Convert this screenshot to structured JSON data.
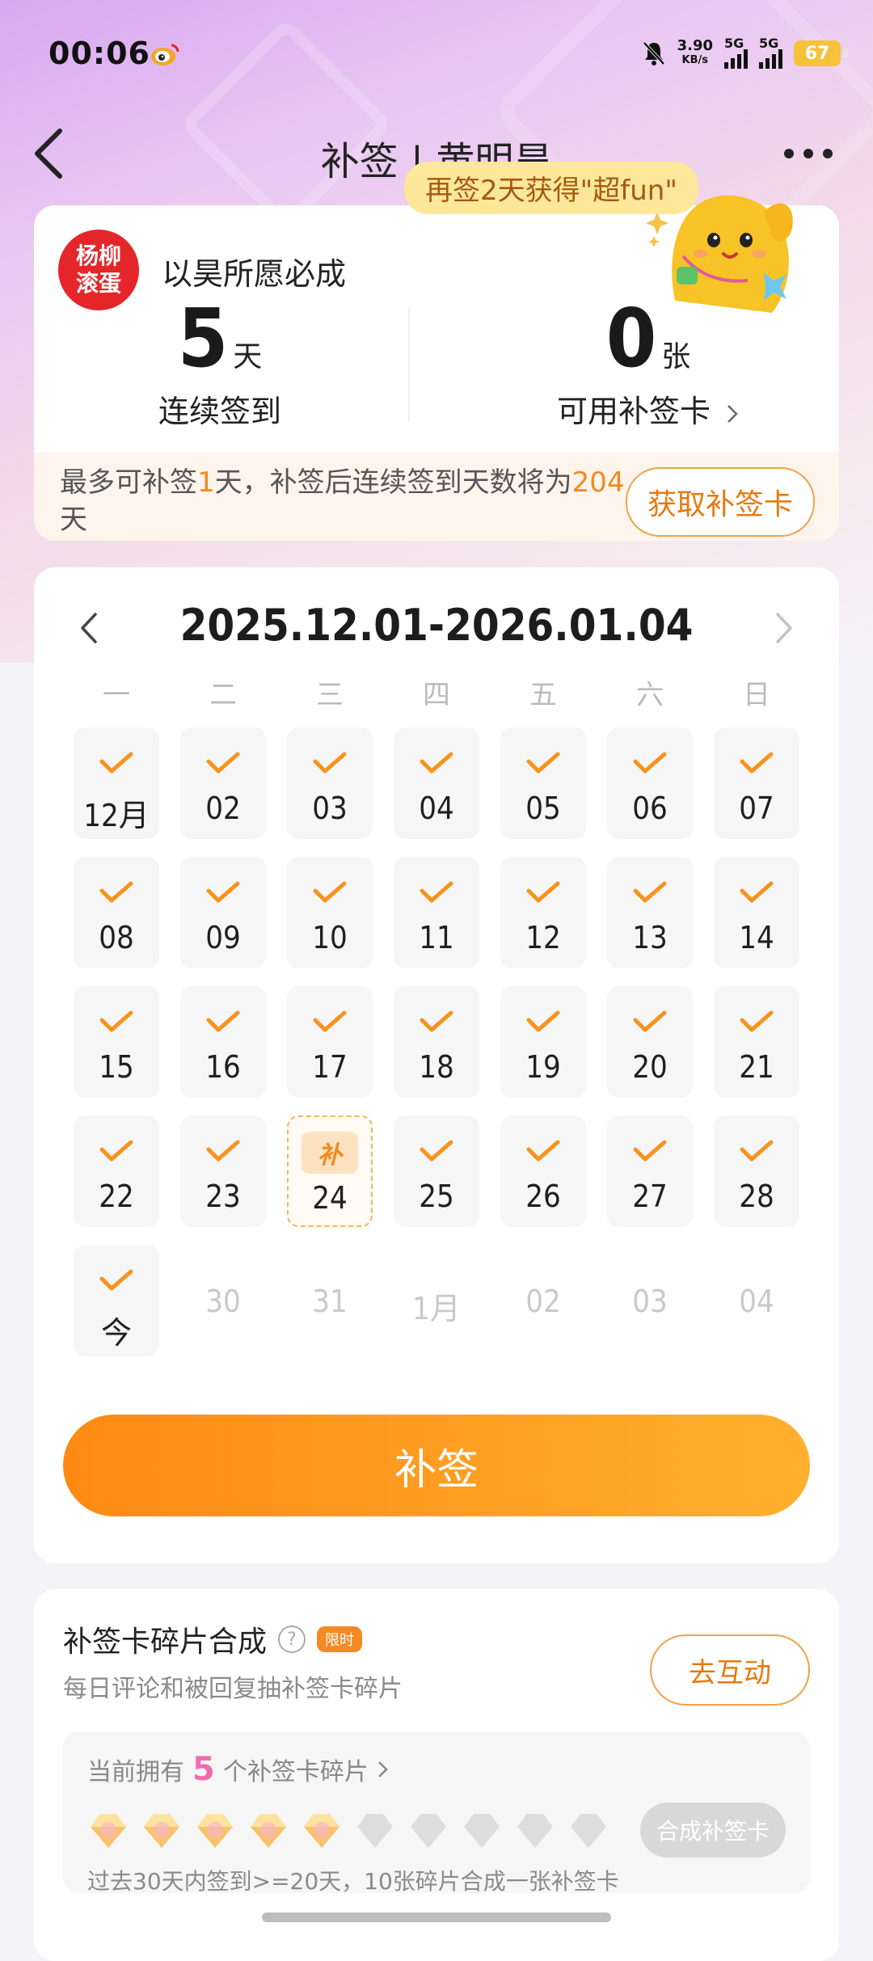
{
  "status_bar": {
    "time": "00:06",
    "speed_value": "3.90",
    "speed_unit": "KB/s",
    "sim1": "5G",
    "sim2": "5G",
    "battery": "67"
  },
  "header": {
    "title": "补签 | 黄明昊",
    "promo": "再签2天获得\"超fun\""
  },
  "summary": {
    "avatar_text_1": "杨柳",
    "avatar_text_2": "滚蛋",
    "user_name": "以昊所愿必成",
    "streak_value": "5",
    "streak_unit": "天",
    "streak_label": "连续签到",
    "cards_value": "0",
    "cards_unit": "张",
    "cards_label": "可用补签卡",
    "foot_prefix": "最多可补签",
    "foot_days": "1",
    "foot_middle": "天，补签后连续签到天数将为",
    "foot_total": "204",
    "foot_suffix": "天",
    "get_card_button": "获取补签卡"
  },
  "calendar": {
    "range": "2025.12.01-2026.01.04",
    "weekdays": [
      "一",
      "二",
      "三",
      "四",
      "五",
      "六",
      "日"
    ],
    "days": [
      {
        "label": "12月",
        "state": "checked"
      },
      {
        "label": "02",
        "state": "checked"
      },
      {
        "label": "03",
        "state": "checked"
      },
      {
        "label": "04",
        "state": "checked"
      },
      {
        "label": "05",
        "state": "checked"
      },
      {
        "label": "06",
        "state": "checked"
      },
      {
        "label": "07",
        "state": "checked"
      },
      {
        "label": "08",
        "state": "checked"
      },
      {
        "label": "09",
        "state": "checked"
      },
      {
        "label": "10",
        "state": "checked"
      },
      {
        "label": "11",
        "state": "checked"
      },
      {
        "label": "12",
        "state": "checked"
      },
      {
        "label": "13",
        "state": "checked"
      },
      {
        "label": "14",
        "state": "checked"
      },
      {
        "label": "15",
        "state": "checked"
      },
      {
        "label": "16",
        "state": "checked"
      },
      {
        "label": "17",
        "state": "checked"
      },
      {
        "label": "18",
        "state": "checked"
      },
      {
        "label": "19",
        "state": "checked"
      },
      {
        "label": "20",
        "state": "checked"
      },
      {
        "label": "21",
        "state": "checked"
      },
      {
        "label": "22",
        "state": "checked"
      },
      {
        "label": "23",
        "state": "checked"
      },
      {
        "label": "24",
        "state": "makeup",
        "badge": "补"
      },
      {
        "label": "25",
        "state": "checked"
      },
      {
        "label": "26",
        "state": "checked"
      },
      {
        "label": "27",
        "state": "checked"
      },
      {
        "label": "28",
        "state": "checked"
      },
      {
        "label": "今",
        "state": "checked"
      },
      {
        "label": "30",
        "state": "future"
      },
      {
        "label": "31",
        "state": "future"
      },
      {
        "label": "1月",
        "state": "future"
      },
      {
        "label": "02",
        "state": "future"
      },
      {
        "label": "03",
        "state": "future"
      },
      {
        "label": "04",
        "state": "future"
      }
    ],
    "resign_button": "补签"
  },
  "fragments": {
    "title": "补签卡碎片合成",
    "help": "?",
    "limited": "限时",
    "desc": "每日评论和被回复抽补签卡碎片",
    "interact_button": "去互动",
    "count_prefix": "当前拥有",
    "count": "5",
    "count_suffix": "个补签卡碎片",
    "owned": 5,
    "total": 10,
    "compose_button": "合成补签卡",
    "rule": "过去30天内签到>=20天，10张碎片合成一张补签卡"
  },
  "colors": {
    "accent": "#f08a1e",
    "check": "#f7931e",
    "fragment_on": "#f8c36b",
    "fragment_off": "#dddddd"
  }
}
